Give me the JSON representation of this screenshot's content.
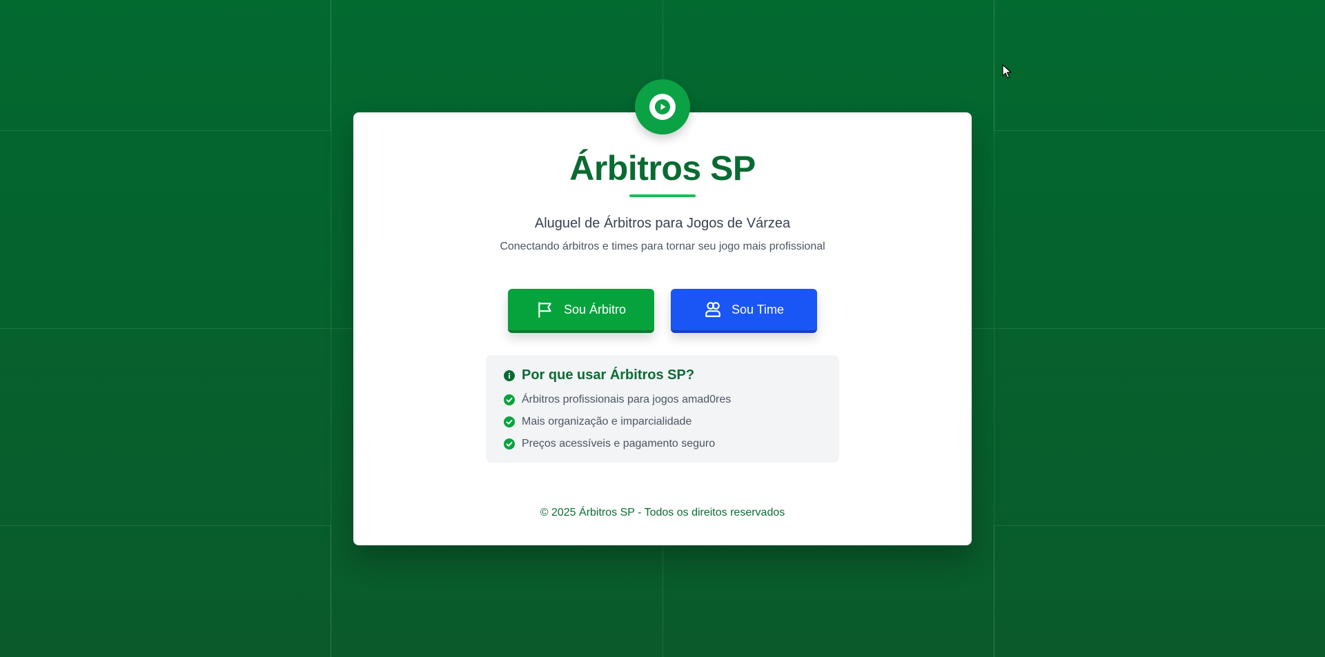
{
  "app": {
    "title": "Árbitros SP",
    "subtitle": "Aluguel de Árbitros para Jogos de Várzea",
    "tagline": "Conectando árbitros e times para tornar seu jogo mais profissional",
    "logo_icon": "play-icon"
  },
  "actions": {
    "referee_label": "Sou Árbitro",
    "referee_icon": "flag-icon",
    "team_label": "Sou Time",
    "team_icon": "users-icon"
  },
  "info": {
    "title": "Por que usar Árbitros SP?",
    "icon": "info-icon",
    "items": [
      "Árbitros profissionais para jogos amad0res",
      "Mais organização e imparcialidade",
      "Preços acessíveis e pagamento seguro"
    ]
  },
  "footer": {
    "text": "© 2025 Árbitros SP - Todos os direitos reservados"
  },
  "colors": {
    "background": "#02692f",
    "brand_green": "#0a6b32",
    "accent_green": "#06a33d",
    "accent_blue": "#1a56f5"
  }
}
